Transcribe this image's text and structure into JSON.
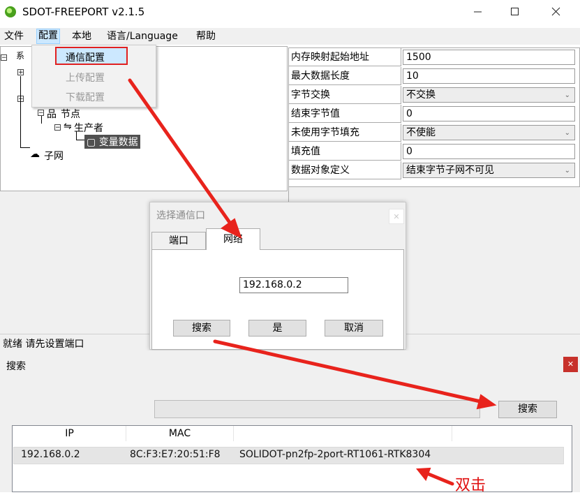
{
  "window": {
    "title": "SDOT-FREEPORT v2.1.5",
    "icons": {
      "minimize": "minimize-icon",
      "maximize": "maximize-icon",
      "close": "close-icon"
    }
  },
  "menu": {
    "file": "文件",
    "config": "配置",
    "local": "本地",
    "language": "语言/Language",
    "help": "帮助"
  },
  "config_menu": {
    "comm": "通信配置",
    "upload": "上传配置",
    "download": "下载配置"
  },
  "tree": {
    "root_partial": "系",
    "node": "节点",
    "producer": "生产者",
    "variable": "变量数据",
    "subnet": "子网"
  },
  "properties": [
    {
      "name": "内存映射起始地址",
      "value": "1500",
      "combo": false
    },
    {
      "name": "最大数据长度",
      "value": "10",
      "combo": false
    },
    {
      "name": "字节交换",
      "value": "不交换",
      "combo": true
    },
    {
      "name": "结束字节值",
      "value": "0",
      "combo": false
    },
    {
      "name": "未使用字节填充",
      "value": "不使能",
      "combo": true
    },
    {
      "name": "填充值",
      "value": "0",
      "combo": false
    },
    {
      "name": "数据对象定义",
      "value": "结束字节子网不可见",
      "combo": true
    }
  ],
  "status": "就绪 请先设置端口",
  "port_dialog": {
    "title": "选择通信口",
    "tab_port": "端口",
    "tab_network": "网络",
    "ip": "192.168.0.2",
    "search": "搜索",
    "yes": "是",
    "cancel": "取消"
  },
  "search_panel": {
    "title": "搜索",
    "search_button": "搜索",
    "columns": [
      "IP",
      "MAC",
      ""
    ],
    "rows": [
      {
        "ip": "192.168.0.2",
        "mac": "8C:F3:E7:20:51:F8",
        "name": "SOLIDOT-pn2fp-2port-RT1061-RTK8304"
      }
    ],
    "annotation": "双击"
  },
  "colors": {
    "arrow": "#e8231c",
    "highlight_box": "#e02020",
    "selection": "#cce8ff"
  }
}
